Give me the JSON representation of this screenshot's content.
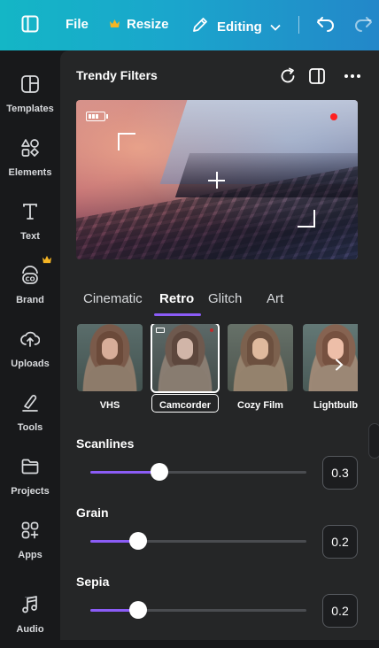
{
  "topbar": {
    "file_label": "File",
    "resize_label": "Resize",
    "editing_label": "Editing"
  },
  "sidebar": {
    "items": [
      {
        "label": "Templates",
        "icon": "templates-icon"
      },
      {
        "label": "Elements",
        "icon": "elements-icon"
      },
      {
        "label": "Text",
        "icon": "text-icon"
      },
      {
        "label": "Brand",
        "icon": "brand-icon"
      },
      {
        "label": "Uploads",
        "icon": "uploads-icon"
      },
      {
        "label": "Tools",
        "icon": "tools-icon"
      },
      {
        "label": "Projects",
        "icon": "projects-icon"
      },
      {
        "label": "Apps",
        "icon": "apps-icon"
      },
      {
        "label": "Audio",
        "icon": "audio-icon"
      }
    ]
  },
  "panel": {
    "title": "Trendy Filters",
    "tabs": [
      {
        "label": "Cinematic",
        "active": false
      },
      {
        "label": "Retro",
        "active": true
      },
      {
        "label": "Glitch",
        "active": false
      },
      {
        "label": "Art",
        "active": false
      }
    ],
    "filters": [
      {
        "label": "VHS",
        "selected": false
      },
      {
        "label": "Camcorder",
        "selected": true
      },
      {
        "label": "Cozy Film",
        "selected": false
      },
      {
        "label": "Lightbulb",
        "selected": false
      }
    ],
    "sliders": [
      {
        "label": "Scanlines",
        "value": "0.3",
        "fraction": 0.32
      },
      {
        "label": "Grain",
        "value": "0.2",
        "fraction": 0.22
      },
      {
        "label": "Sepia",
        "value": "0.2",
        "fraction": 0.22
      }
    ]
  },
  "colors": {
    "accent": "#8b5cf6",
    "topbar_start": "#14b6c6",
    "topbar_end": "#2387c9",
    "recording_dot": "#ff2020",
    "crown": "#f5b524"
  }
}
